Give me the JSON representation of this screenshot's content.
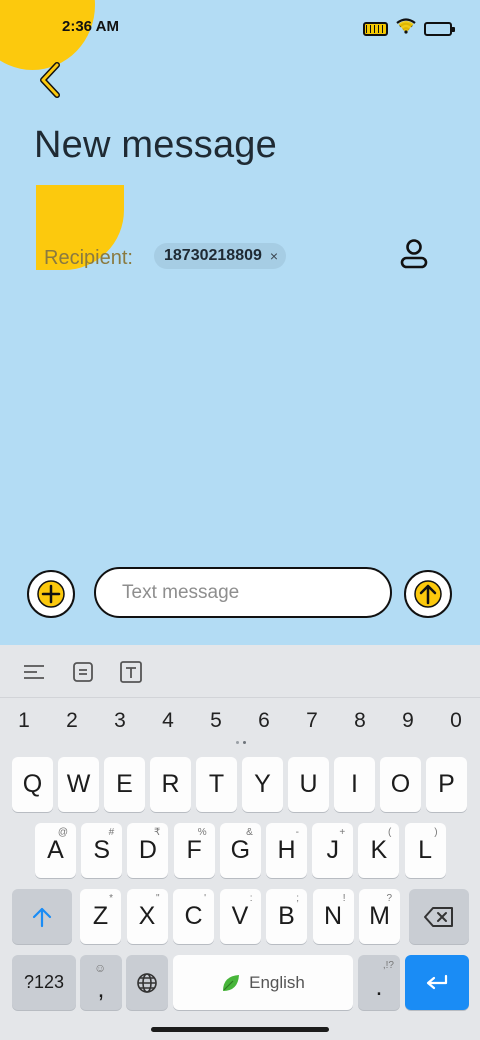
{
  "status": {
    "time": "2:36 AM"
  },
  "header": {
    "title": "New message"
  },
  "recipient": {
    "label": "Recipient:",
    "chip_text": "18730218809",
    "chip_remove": "×"
  },
  "composer": {
    "placeholder": "Text message"
  },
  "keyboard": {
    "numbers": [
      "1",
      "2",
      "3",
      "4",
      "5",
      "6",
      "7",
      "8",
      "9",
      "0"
    ],
    "row1": [
      {
        "key": "Q"
      },
      {
        "key": "W"
      },
      {
        "key": "E"
      },
      {
        "key": "R"
      },
      {
        "key": "T"
      },
      {
        "key": "Y"
      },
      {
        "key": "U"
      },
      {
        "key": "I"
      },
      {
        "key": "O"
      },
      {
        "key": "P"
      }
    ],
    "row2": [
      {
        "key": "A",
        "sub": "@"
      },
      {
        "key": "S",
        "sub": "#"
      },
      {
        "key": "D",
        "sub": "₹"
      },
      {
        "key": "F",
        "sub": "%"
      },
      {
        "key": "G",
        "sub": "&"
      },
      {
        "key": "H",
        "sub": "-"
      },
      {
        "key": "J",
        "sub": "+"
      },
      {
        "key": "K",
        "sub": "("
      },
      {
        "key": "L",
        "sub": ")"
      }
    ],
    "row3": [
      {
        "key": "Z",
        "sub": "*"
      },
      {
        "key": "X",
        "sub": "\""
      },
      {
        "key": "C",
        "sub": "'"
      },
      {
        "key": "V",
        "sub": ":"
      },
      {
        "key": "B",
        "sub": ";"
      },
      {
        "key": "N",
        "sub": "!"
      },
      {
        "key": "M",
        "sub": "?"
      }
    ],
    "symbols_label": "?123",
    "comma_label": ",",
    "space_label": "English",
    "period_label": ".",
    "period_sub": ",!?"
  },
  "colors": {
    "accent": "#fcc90d",
    "background": "#b3dcf4",
    "enter": "#1a8cf5"
  }
}
